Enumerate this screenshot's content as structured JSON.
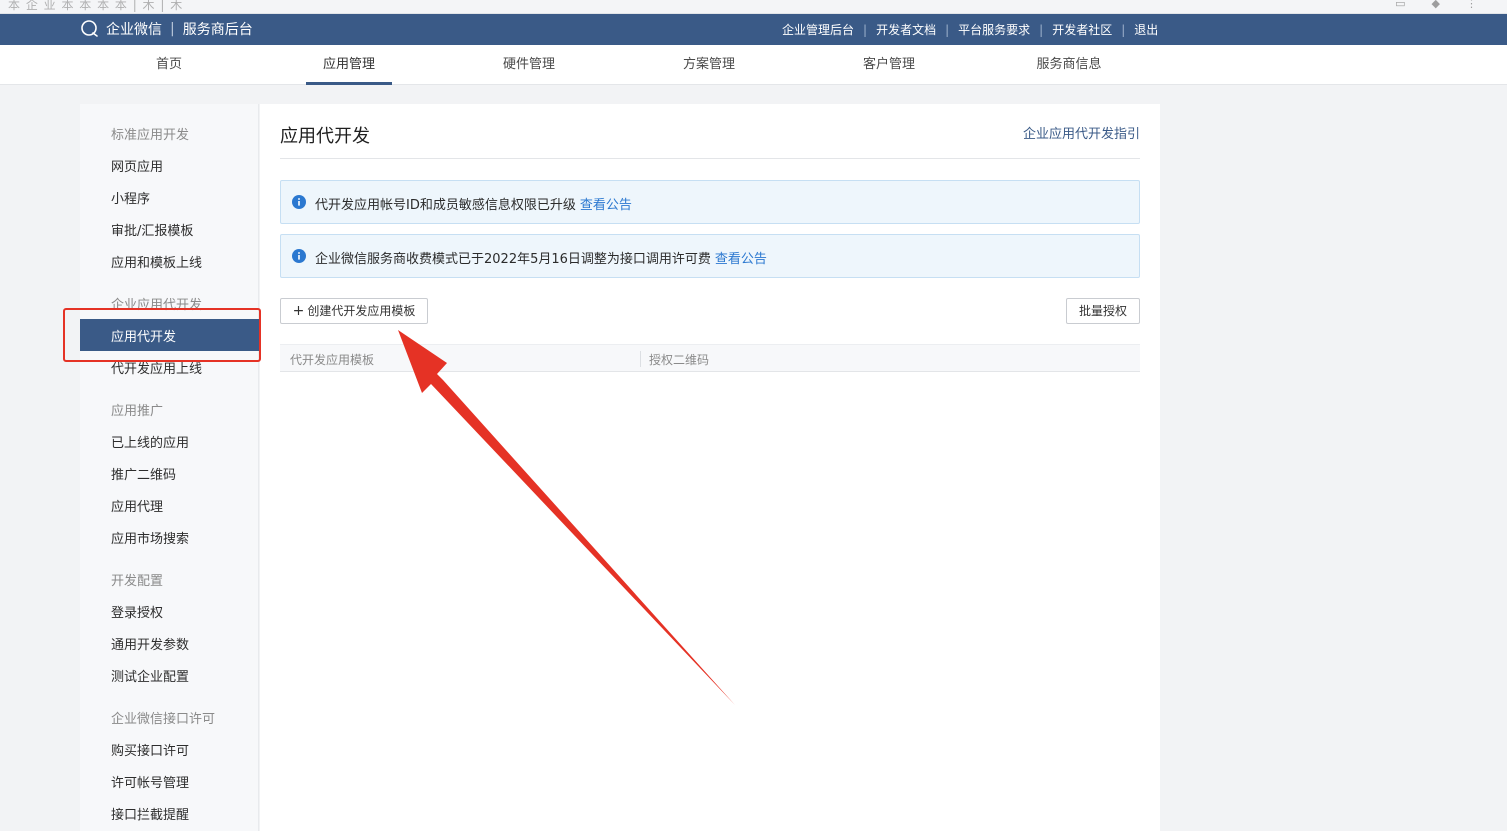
{
  "browser": {
    "faded_title": "本 企 业 本 本 本 本 | 木 | 木"
  },
  "header": {
    "brand": "企业微信",
    "subtitle": "服务商后台",
    "links": [
      "企业管理后台",
      "开发者文档",
      "平台服务要求",
      "开发者社区",
      "退出"
    ]
  },
  "nav": {
    "tabs": [
      "首页",
      "应用管理",
      "硬件管理",
      "方案管理",
      "客户管理",
      "服务商信息"
    ],
    "active_index": 1
  },
  "sidebar": {
    "groups": [
      {
        "title": "标准应用开发",
        "items": [
          "网页应用",
          "小程序",
          "审批/汇报模板",
          "应用和模板上线"
        ]
      },
      {
        "title": "企业应用代开发",
        "items": [
          "应用代开发",
          "代开发应用上线"
        ]
      },
      {
        "title": "应用推广",
        "items": [
          "已上线的应用",
          "推广二维码",
          "应用代理",
          "应用市场搜索"
        ]
      },
      {
        "title": "开发配置",
        "items": [
          "登录授权",
          "通用开发参数",
          "测试企业配置"
        ]
      },
      {
        "title": "企业微信接口许可",
        "items": [
          "购买接口许可",
          "许可帐号管理",
          "接口拦截提醒"
        ]
      }
    ],
    "active_item": "应用代开发"
  },
  "main": {
    "title": "应用代开发",
    "guide_link": "企业应用代开发指引",
    "notices": [
      {
        "text": "代开发应用帐号ID和成员敏感信息权限已升级",
        "link": "查看公告"
      },
      {
        "text": "企业微信服务商收费模式已于2022年5月16日调整为接口调用许可费",
        "link": "查看公告"
      }
    ],
    "create_button": "创建代开发应用模板",
    "batch_button": "批量授权",
    "table_columns": [
      "代开发应用模板",
      "授权二维码"
    ]
  },
  "colors": {
    "header_bg": "#3a5a87",
    "active_item_bg": "#3a5a87",
    "notice_bg": "#eef6fc",
    "link": "#2b78d0",
    "annotation_red": "#e53225"
  }
}
